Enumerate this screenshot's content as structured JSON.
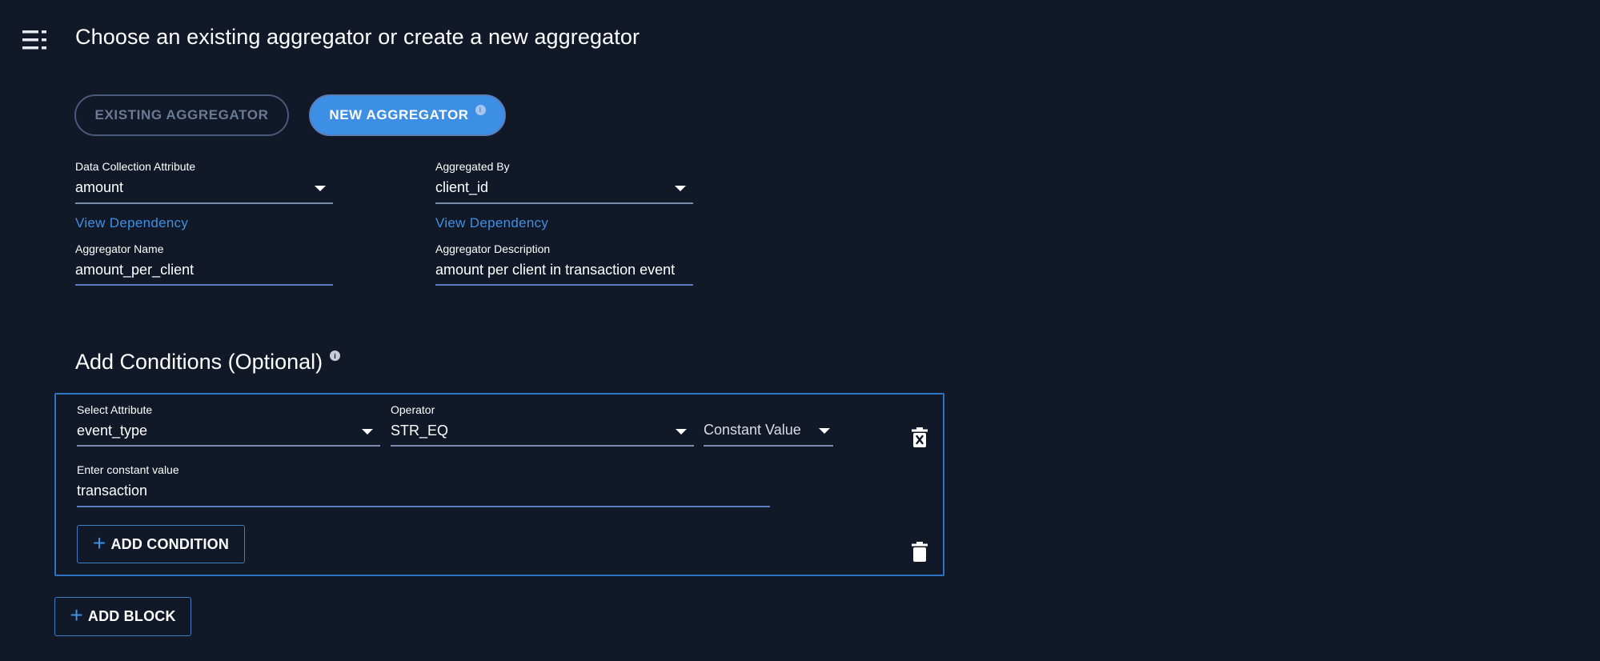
{
  "header": {
    "menu_icon": "menu-icon",
    "title": "Choose an existing aggregator or create a new aggregator"
  },
  "toggle": {
    "existing_label": "EXISTING AGGREGATOR",
    "new_label": "NEW AGGREGATOR",
    "selected": "new",
    "active_color": "#3d8fe6"
  },
  "form": {
    "data_collection_attribute": {
      "label": "Data Collection Attribute",
      "value": "amount"
    },
    "aggregated_by": {
      "label": "Aggregated By",
      "value": "client_id"
    },
    "view_dependency_label": "View Dependency",
    "aggregator_name": {
      "label": "Aggregator Name",
      "value": "amount_per_client"
    },
    "aggregator_description": {
      "label": "Aggregator Description",
      "value": "amount per client in transaction event"
    }
  },
  "conditions": {
    "title": "Add Conditions (Optional)",
    "blocks": [
      {
        "rows": [
          {
            "attribute": {
              "label": "Select Attribute",
              "value": "event_type"
            },
            "operator": {
              "label": "Operator",
              "value": "STR_EQ"
            },
            "value_type": "Constant Value",
            "constant": {
              "label": "Enter constant value",
              "value": "transaction"
            }
          }
        ],
        "add_condition_label": "ADD CONDITION"
      }
    ],
    "add_block_label": "ADD BLOCK"
  },
  "colors": {
    "background": "#111827",
    "accent": "#3f8fe3",
    "border": "#2c74c4"
  }
}
